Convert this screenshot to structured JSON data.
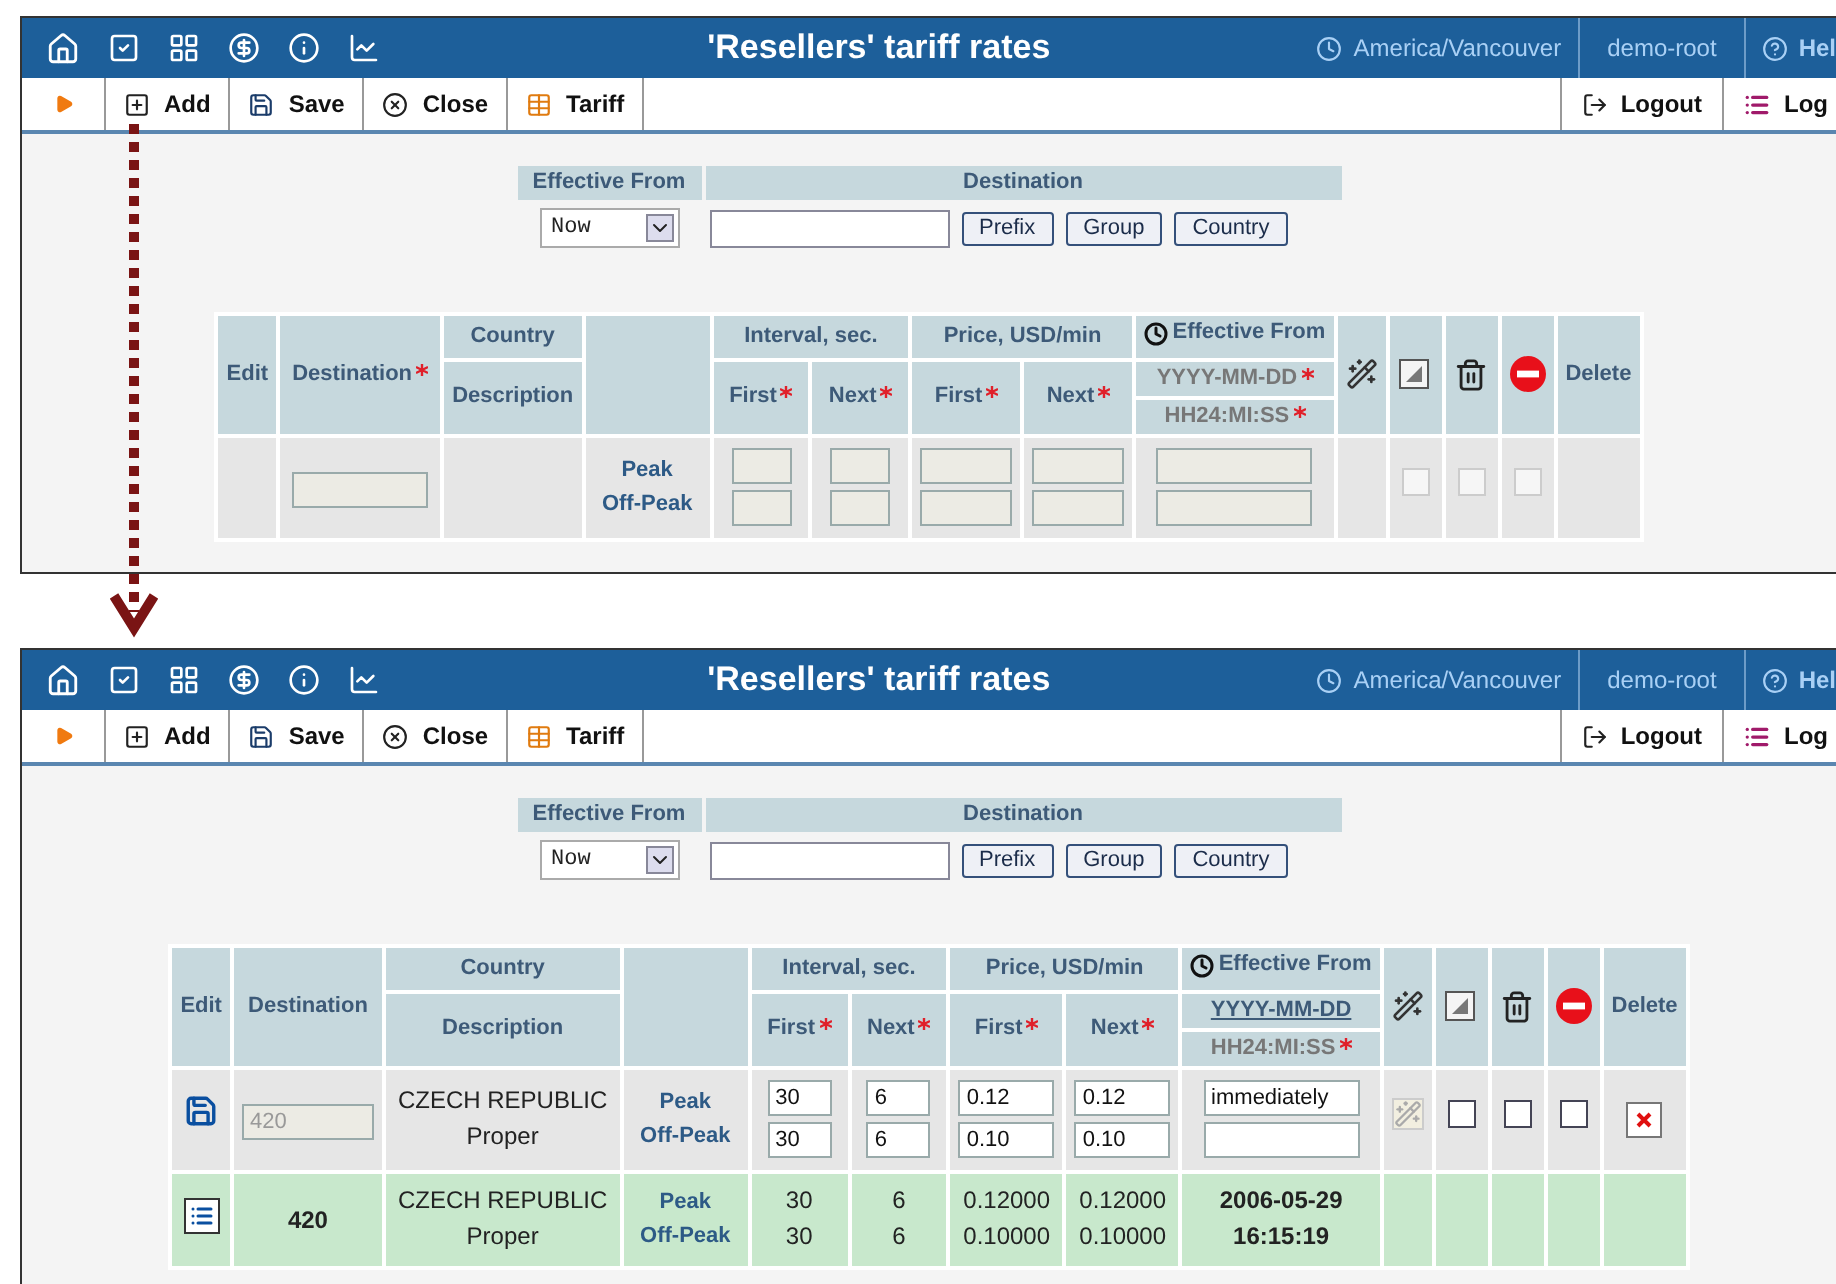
{
  "panels": [
    {
      "title": "'Resellers' tariff rates",
      "timezone": "America/Vancouver",
      "user": "demo-root",
      "help": "Hel",
      "toolbar": [
        {
          "label": "Add"
        },
        {
          "label": "Save"
        },
        {
          "label": "Close"
        },
        {
          "label": "Tariff"
        }
      ],
      "logout": "Logout",
      "log": "Log",
      "filter": {
        "effective_from_label": "Effective From",
        "destination_label": "Destination",
        "select_value": "Now",
        "buttons": [
          "Prefix",
          "Group",
          "Country"
        ]
      },
      "header": {
        "edit": "Edit",
        "destination": {
          "label": "Destination",
          "required": true
        },
        "country": "Country",
        "description": "Description",
        "interval": "Interval, sec.",
        "price": "Price, USD/min",
        "first_interval": {
          "label": "First",
          "required": true
        },
        "next_interval": {
          "label": "Next",
          "required": true
        },
        "first_price": {
          "label": "First",
          "required": true
        },
        "next_price": {
          "label": "Next",
          "required": true
        },
        "effective_from": "Effective From",
        "date_format": {
          "label": "YYYY-MM-DD",
          "required": true,
          "underlined": false
        },
        "time_format": {
          "label": "HH24:MI:SS",
          "required": true
        },
        "delete": "Delete"
      },
      "rows": [
        {
          "kind": "new",
          "tiers": [
            "Peak",
            "Off-Peak"
          ],
          "checkboxes": [
            {
              "checked": false,
              "disabled": true
            },
            {
              "checked": false,
              "disabled": true
            },
            {
              "checked": false,
              "disabled": true
            }
          ]
        }
      ]
    },
    {
      "title": "'Resellers' tariff rates",
      "timezone": "America/Vancouver",
      "user": "demo-root",
      "help": "Hel",
      "toolbar": [
        {
          "label": "Add"
        },
        {
          "label": "Save"
        },
        {
          "label": "Close"
        },
        {
          "label": "Tariff"
        }
      ],
      "logout": "Logout",
      "log": "Log",
      "filter": {
        "effective_from_label": "Effective From",
        "destination_label": "Destination",
        "select_value": "Now",
        "buttons": [
          "Prefix",
          "Group",
          "Country"
        ]
      },
      "header": {
        "edit": "Edit",
        "destination": {
          "label": "Destination",
          "required": false
        },
        "country": "Country",
        "description": "Description",
        "interval": "Interval, sec.",
        "price": "Price, USD/min",
        "first_interval": {
          "label": "First",
          "required": true
        },
        "next_interval": {
          "label": "Next",
          "required": true
        },
        "first_price": {
          "label": "First",
          "required": true
        },
        "next_price": {
          "label": "Next",
          "required": true
        },
        "effective_from": "Effective From",
        "date_format": {
          "label": "YYYY-MM-DD",
          "required": false,
          "underlined": true
        },
        "time_format": {
          "label": "HH24:MI:SS",
          "required": true
        },
        "delete": "Delete"
      },
      "rows": [
        {
          "kind": "edit",
          "destination": "420",
          "country": "CZECH REPUBLIC",
          "description": "Proper",
          "tiers": [
            "Peak",
            "Off-Peak"
          ],
          "first_interval": [
            "30",
            "30"
          ],
          "next_interval": [
            "6",
            "6"
          ],
          "first_price": [
            "0.12",
            "0.10"
          ],
          "next_price": [
            "0.12",
            "0.10"
          ],
          "effective_from": "immediately",
          "checkboxes": [
            {
              "checked": false,
              "disabled": false
            },
            {
              "checked": false,
              "disabled": false
            },
            {
              "checked": false,
              "disabled": false
            }
          ]
        },
        {
          "kind": "saved",
          "destination": "420",
          "country": "CZECH REPUBLIC",
          "description": "Proper",
          "tiers": [
            "Peak",
            "Off-Peak"
          ],
          "first_interval": [
            "30",
            "30"
          ],
          "next_interval": [
            "6",
            "6"
          ],
          "first_price": [
            "0.12000",
            "0.10000"
          ],
          "next_price": [
            "0.12000",
            "0.10000"
          ],
          "effective_date": "2006-05-29",
          "effective_time": "16:15:19"
        }
      ]
    }
  ]
}
